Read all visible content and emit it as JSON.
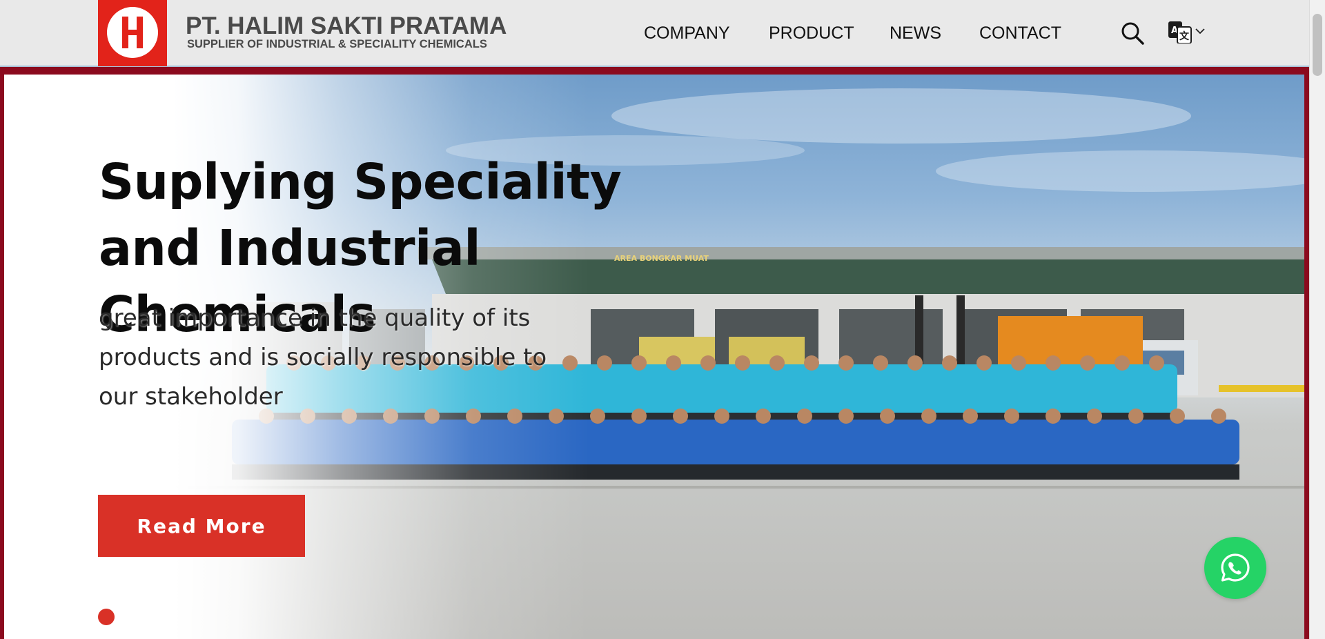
{
  "header": {
    "logo_name": "halim-sakti-logo",
    "company_name": "PT. HALIM SAKTI PRATAMA",
    "tagline": "SUPPLIER OF INDUSTRIAL & SPECIALITY CHEMICALS",
    "brand_red": "#e2231a"
  },
  "nav": {
    "items": [
      {
        "label": "COMPANY"
      },
      {
        "label": "PRODUCT"
      },
      {
        "label": "NEWS"
      },
      {
        "label": "CONTACT"
      }
    ],
    "search_icon": "search-icon",
    "language_icon": "translate-icon",
    "language_chevron": "chevron-down-icon"
  },
  "hero": {
    "title": "Suplying Speciality and Industrial Chemicals",
    "subtitle": "great importance in the quality of its products and is socially responsible to our stakeholder",
    "cta_label": "Read More",
    "sign_text": "AREA BONGKAR MUAT",
    "accent": "#d93127",
    "frame_color": "#8b0a1e"
  },
  "floating": {
    "whatsapp_icon": "whatsapp-icon",
    "whatsapp_color": "#25d366"
  }
}
